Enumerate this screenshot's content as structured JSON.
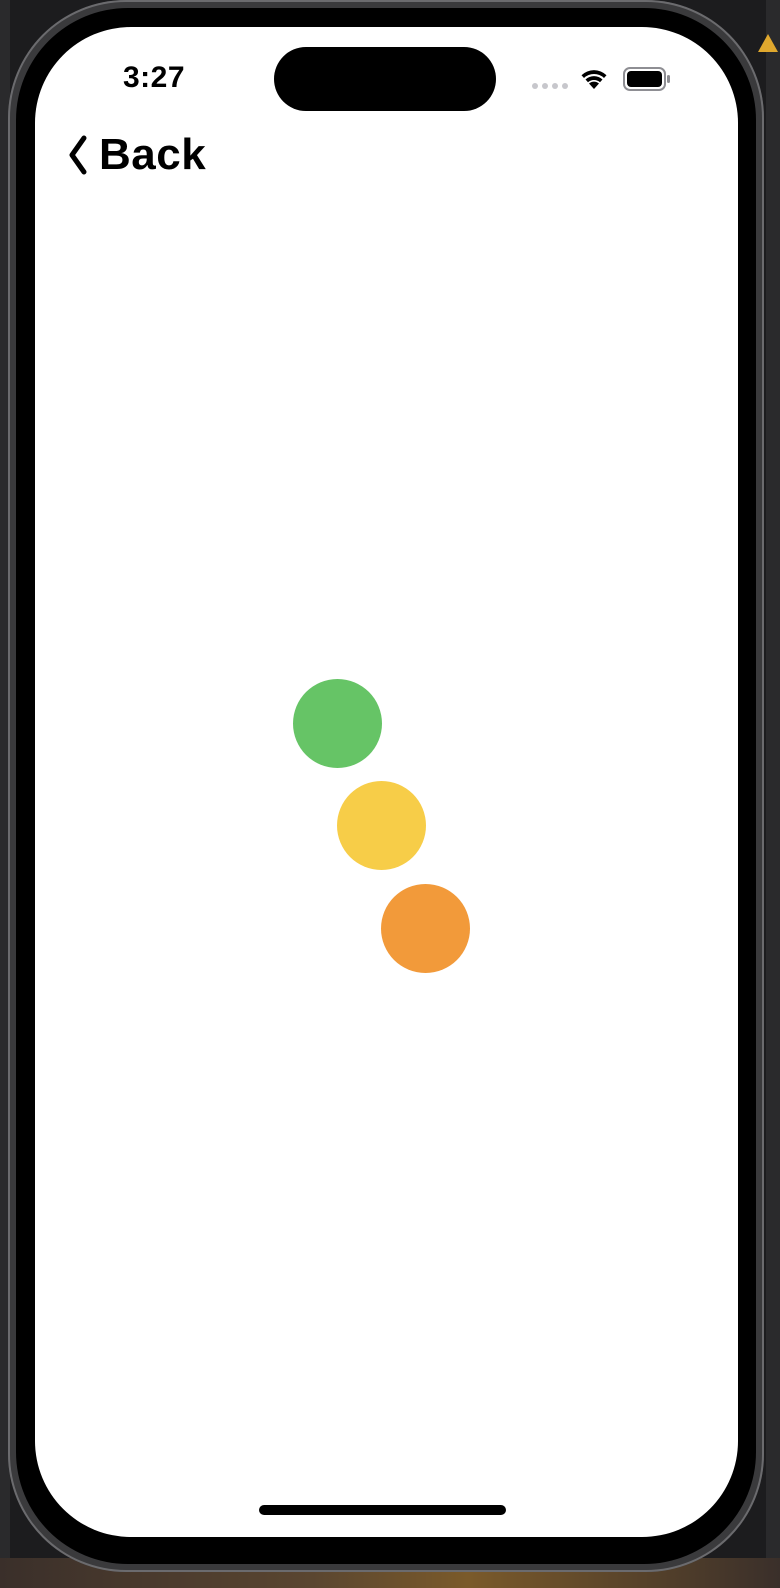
{
  "status_bar": {
    "time": "3:27"
  },
  "nav": {
    "back_label": "Back"
  },
  "loading_dots": [
    {
      "color": "#66c466"
    },
    {
      "color": "#f7cd48"
    },
    {
      "color": "#f29a3a"
    }
  ],
  "icons": {
    "back": "chevron-left-icon",
    "signal": "cellular-signal-icon",
    "wifi": "wifi-icon",
    "battery": "battery-icon",
    "warning": "warning-icon"
  }
}
